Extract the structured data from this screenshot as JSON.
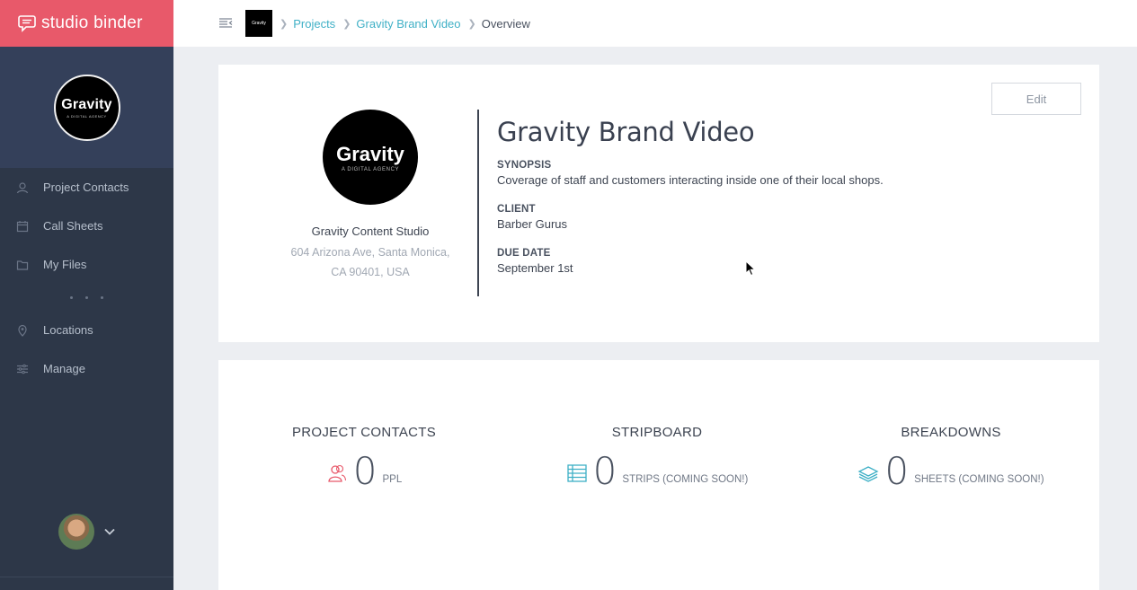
{
  "brand": {
    "name": "studio binder",
    "color": "#e8596a"
  },
  "sidebar": {
    "project_avatar": {
      "title": "Gravity",
      "subtitle": "A DIGITAL AGENCY"
    },
    "items": [
      {
        "label": "Project Contacts",
        "icon": "contacts-icon"
      },
      {
        "label": "Call Sheets",
        "icon": "calendar-icon"
      },
      {
        "label": "My Files",
        "icon": "folder-icon"
      },
      {
        "label": "Locations",
        "icon": "location-pin-icon"
      },
      {
        "label": "Manage",
        "icon": "sliders-icon"
      }
    ]
  },
  "breadcrumb": {
    "thumb_text": "Gravity",
    "items": [
      "Projects",
      "Gravity Brand Video",
      "Overview"
    ]
  },
  "overview": {
    "edit_label": "Edit",
    "client": {
      "logo_title": "Gravity",
      "logo_subtitle": "A DIGITAL AGENCY",
      "name": "Gravity Content Studio",
      "address_line1": "604 Arizona Ave, Santa Monica,",
      "address_line2": "CA 90401, USA"
    },
    "title": "Gravity Brand Video",
    "synopsis_label": "SYNOPSIS",
    "synopsis": "Coverage of staff and customers interacting inside one of their local shops.",
    "client_label": "CLIENT",
    "client_value": "Barber Gurus",
    "due_label": "DUE DATE",
    "due_value": "September 1st"
  },
  "stats": [
    {
      "title": "PROJECT CONTACTS",
      "value": "0",
      "unit": "PPL",
      "icon": "people-icon",
      "color": "#e8596a"
    },
    {
      "title": "STRIPBOARD",
      "value": "0",
      "unit": "STRIPS (COMING SOON!)",
      "icon": "stripboard-icon",
      "color": "#3fb0c6"
    },
    {
      "title": "BREAKDOWNS",
      "value": "0",
      "unit": "SHEETS (COMING SOON!)",
      "icon": "layers-icon",
      "color": "#3fb0c6"
    }
  ]
}
